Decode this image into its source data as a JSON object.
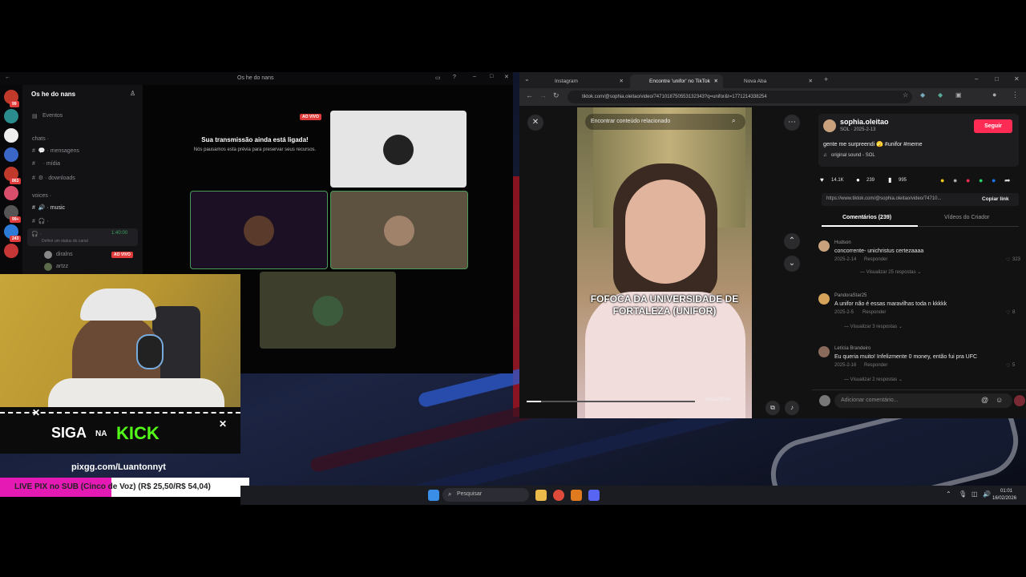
{
  "colors": {
    "accent_pink": "#fe2c55",
    "kick_green": "#53fc18",
    "live_red": "#e03b3b",
    "pix_magenta": "#e51ab5"
  },
  "discord": {
    "title": "Os he do nans",
    "server_name": "Os he do nans",
    "events_label": "Eventos",
    "chats_header": "chats ·",
    "channels": [
      "mensagens",
      "mídia",
      "downloads"
    ],
    "voices_header": "voices ·",
    "voice_channel": "music",
    "user_status": "Definir um status do canal",
    "voice_timer": "1:40:00",
    "voice_users": [
      "diralns",
      "artzz"
    ],
    "live_badge": "AO VIVO",
    "stream_title": "Sua transmissão ainda está ligada!",
    "stream_sub": "Nós pausamos esta prévia para preservar seus recursos.",
    "badge_counts": [
      "99",
      "863",
      "99+",
      "243"
    ]
  },
  "kick": {
    "siga": "SIGA",
    "na": "NA",
    "kick": "KICK",
    "pix_link": "pixgg.com/Luantonnyt"
  },
  "pix": {
    "label": "LIVE PIX no SUB (Cinco de Voz) (R$ 25,50/R$ 54,04)"
  },
  "browser": {
    "tabs": [
      "Instagram",
      "Encontre 'unifor' no TikTok",
      "Nova Aba"
    ],
    "url": "tiktok.com/@sophia.oleitao/video/7471018750553132343?q=unifor&t=1771214338254",
    "search_placeholder": "Encontrar conteúdo relacionado",
    "caption": "FOFOCA DA UNIVERSIDADE DE FORTALEZA (UNIFOR)",
    "time": "00:21/00:49",
    "author": "sophia.oleitao",
    "author_sub": "SOL · 2025-2-13",
    "follow": "Seguir",
    "description": "gente me surpreendi 🫣 #unifor #meme",
    "sound": "original sound - SOL",
    "likes": "14.1K",
    "comments_count": "239",
    "saves": "995",
    "link": "https://www.tiktok.com/@sophia.oleitao/video/74710...",
    "copy_link": "Copiar link",
    "tab_comments": "Comentários (239)",
    "tab_creator": "Vídeos do Criador",
    "comments": [
      {
        "name": "Hudson",
        "text": "concorrente- unichristus certezaaaa",
        "date": "2025-2-14",
        "reply": "Responder",
        "likes": "323",
        "more": "Visualizar 25 respostas"
      },
      {
        "name": "PandoraStar25",
        "text": "A unifor não é essas maravilhas toda n kkkkk",
        "date": "2025-2-5",
        "reply": "Responder",
        "likes": "8",
        "more": "Visualizar 3 respostas"
      },
      {
        "name": "Letícia Brandeiro",
        "text": "Eu queria muito! Infelizmente 0 money, então fui pra UFC",
        "date": "2025-2-16",
        "reply": "Responder",
        "likes": "5",
        "more": "Visualizar 2 respostas"
      }
    ],
    "add_comment": "Adicionar comentário..."
  },
  "taskbar": {
    "search": "Pesquisar",
    "time": "01:01",
    "date": "16/02/2026"
  }
}
